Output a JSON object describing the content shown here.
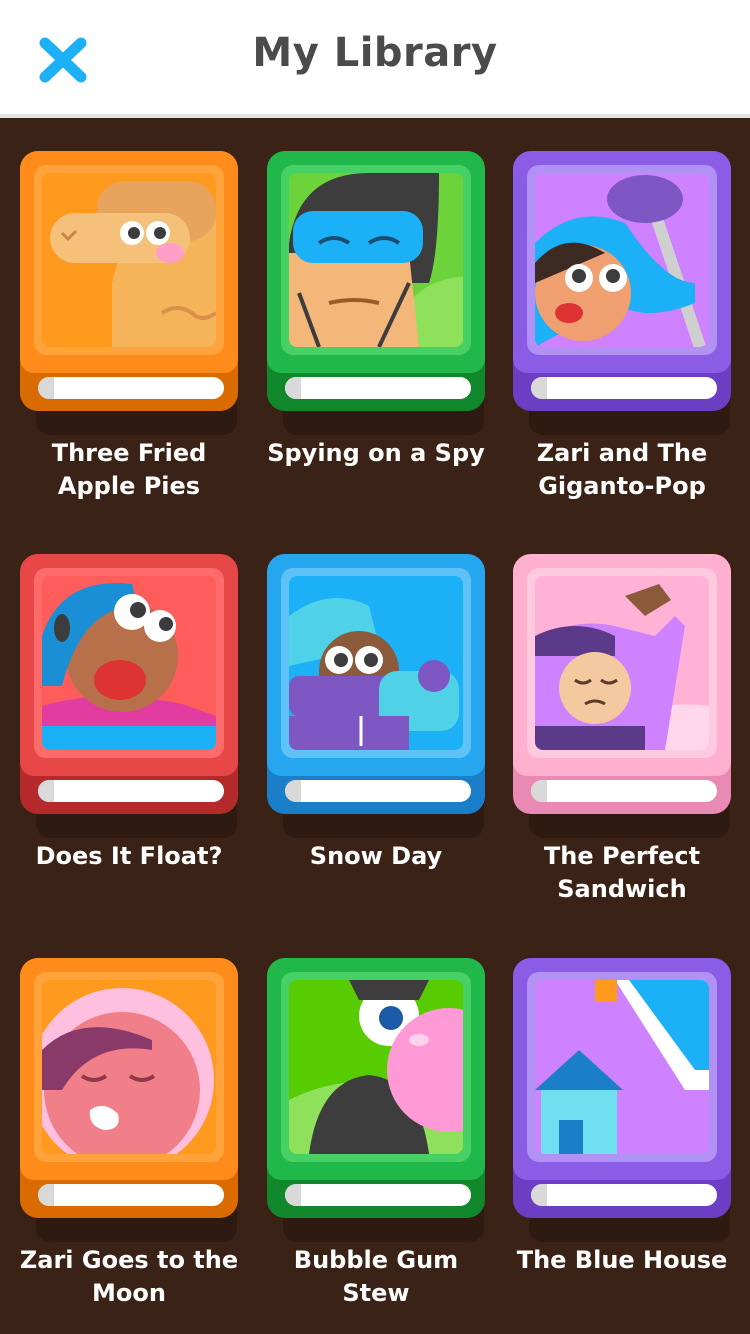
{
  "header": {
    "title": "My Library",
    "close_icon": "close-x-icon",
    "close_color": "#1cb0f6"
  },
  "books": [
    {
      "title_line1": "Three Fried",
      "title_line2": "Apple Pies",
      "theme": "orange",
      "art_icon": "camel-cover-illustration"
    },
    {
      "title_line1": "Spying on a Spy",
      "title_line2": "",
      "theme": "green",
      "art_icon": "spy-cover-illustration"
    },
    {
      "title_line1": "Zari and The",
      "title_line2": "Giganto-Pop",
      "theme": "purple",
      "art_icon": "lollipop-cover-illustration"
    },
    {
      "title_line1": "Does It Float?",
      "title_line2": "",
      "theme": "red",
      "art_icon": "swimmer-cover-illustration"
    },
    {
      "title_line1": "Snow Day",
      "title_line2": "",
      "theme": "blue",
      "art_icon": "snow-cover-illustration"
    },
    {
      "title_line1": "The Perfect",
      "title_line2": "Sandwich",
      "theme": "pink",
      "art_icon": "sandwich-cover-illustration"
    },
    {
      "title_line1": "Zari Goes to the",
      "title_line2": "Moon",
      "theme": "orange",
      "art_icon": "astronaut-cover-illustration"
    },
    {
      "title_line1": "Bubble Gum",
      "title_line2": "Stew",
      "theme": "green",
      "art_icon": "bubble-gum-cover-illustration"
    },
    {
      "title_line1": "The Blue House",
      "title_line2": "",
      "theme": "purple",
      "art_icon": "house-cover-illustration"
    }
  ]
}
